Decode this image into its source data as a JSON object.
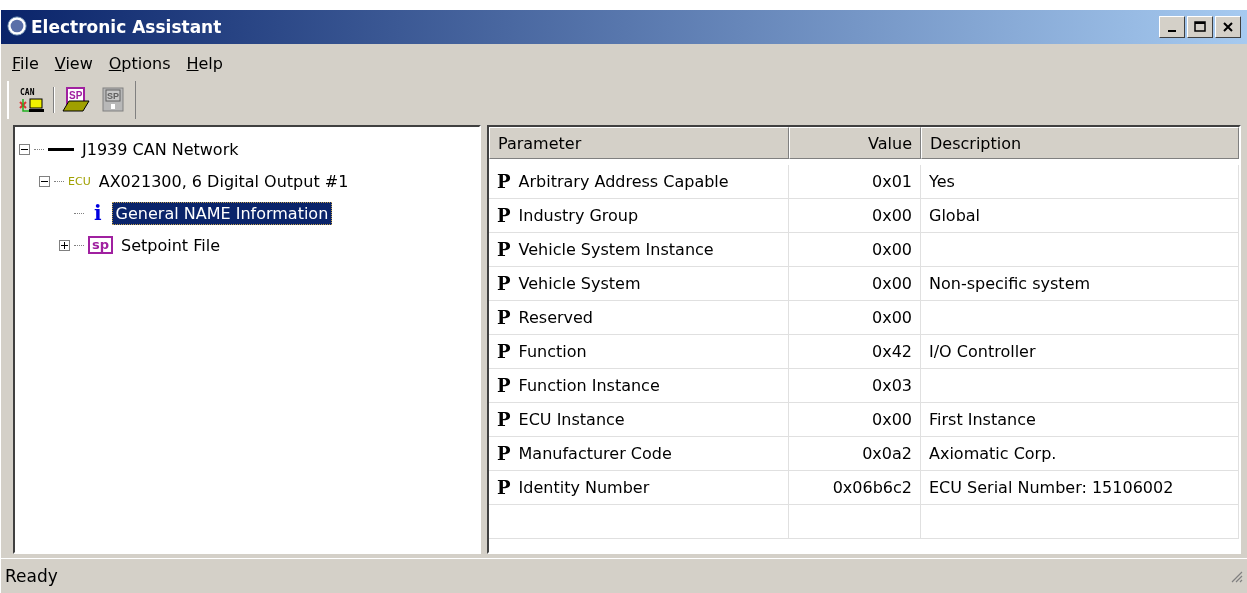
{
  "window": {
    "title": "Electronic Assistant"
  },
  "menu": [
    {
      "label": "File"
    },
    {
      "label": "View"
    },
    {
      "label": "Options"
    },
    {
      "label": "Help"
    }
  ],
  "toolbar": [
    {
      "kind": "can",
      "label": "CAN",
      "disabled": false
    },
    {
      "kind": "open-sp",
      "label": "SP",
      "disabled": false
    },
    {
      "kind": "save-sp",
      "label": "SP",
      "disabled": true
    }
  ],
  "tree": [
    {
      "kind": "network",
      "label": "J1939 CAN Network",
      "expanded": true,
      "selected": false,
      "children": [
        {
          "kind": "ecu",
          "badge": "ECU",
          "label": "AX021300, 6 Digital Output #1",
          "expanded": true,
          "selected": false,
          "children": [
            {
              "kind": "info",
              "badge": "i",
              "label": "General NAME Information",
              "selected": true
            },
            {
              "kind": "setpoint",
              "badge": "sp",
              "label": "Setpoint File",
              "expanded": false,
              "selected": false
            }
          ]
        }
      ]
    }
  ],
  "table": {
    "columns": [
      "Parameter",
      "Value",
      "Description"
    ],
    "rows": [
      {
        "marker": "P",
        "parameter": "Arbitrary Address Capable",
        "value": "0x01",
        "description": "Yes"
      },
      {
        "marker": "P",
        "parameter": "Industry Group",
        "value": "0x00",
        "description": "Global"
      },
      {
        "marker": "P",
        "parameter": "Vehicle System Instance",
        "value": "0x00"
      },
      {
        "marker": "P",
        "parameter": "Vehicle System",
        "value": "0x00",
        "description": "Non-specific system"
      },
      {
        "marker": "P",
        "parameter": "Reserved",
        "value": "0x00"
      },
      {
        "marker": "P",
        "parameter": "Function",
        "value": "0x42",
        "description": "I/O Controller"
      },
      {
        "marker": "P",
        "parameter": "Function Instance",
        "value": "0x03"
      },
      {
        "marker": "P",
        "parameter": "ECU Instance",
        "value": "0x00",
        "description": "First Instance"
      },
      {
        "marker": "P",
        "parameter": "Manufacturer Code",
        "value": "0x0a2",
        "description": "Axiomatic Corp."
      },
      {
        "marker": "P",
        "parameter": "Identity Number",
        "value": "0x06b6c2",
        "description": "ECU Serial Number: 15106002"
      }
    ]
  },
  "status_bar": {
    "text": "Ready"
  }
}
